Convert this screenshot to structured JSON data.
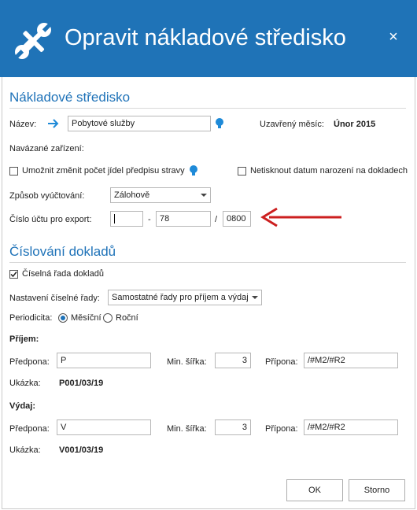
{
  "window": {
    "title": "Opravit nákladové středisko",
    "close_glyph": "×"
  },
  "section1": {
    "title": "Nákladové středisko",
    "name_label": "Název:",
    "name_value": "Pobytové služby",
    "closed_month_label": "Uzavřený měsíc:",
    "closed_month_value": "Únor 2015",
    "linked_devices_label": "Navázané zařízení:",
    "allow_change_label": "Umožnit změnit počet jídel předpisu stravy",
    "allow_change_checked": false,
    "no_birthdate_label": "Netisknout datum narození na dokladech",
    "no_birthdate_checked": false,
    "billing_label": "Způsob vyúčtování:",
    "billing_value": "Zálohově",
    "account_label": "Číslo účtu pro export:",
    "account_prefix": "",
    "account_dash": "-",
    "account_number": "78",
    "account_slash": "/",
    "account_bank": "0800"
  },
  "section2": {
    "title": "Číslování dokladů",
    "series_checkbox_label": "Číselná řada dokladů",
    "series_checked": true,
    "series_setting_label": "Nastavení číselné řady:",
    "series_setting_value": "Samostatné řady pro příjem a výdaj",
    "periodicity_label": "Periodicita:",
    "monthly_label": "Měsíční",
    "yearly_label": "Roční",
    "periodicity_selected": "Měsíční",
    "income": {
      "heading": "Příjem:",
      "prefix_label": "Předpona:",
      "prefix_value": "P",
      "min_width_label": "Min. šířka:",
      "min_width_value": "3",
      "suffix_label": "Přípona:",
      "suffix_value": "/#M2/#R2",
      "example_label": "Ukázka:",
      "example_value": "P001/03/19"
    },
    "expense": {
      "heading": "Výdaj:",
      "prefix_label": "Předpona:",
      "prefix_value": "V",
      "min_width_label": "Min. šířka:",
      "min_width_value": "3",
      "suffix_label": "Přípona:",
      "suffix_value": "/#M2/#R2",
      "example_label": "Ukázka:",
      "example_value": "V001/03/19"
    }
  },
  "buttons": {
    "ok": "OK",
    "cancel": "Storno"
  },
  "colors": {
    "titlebar": "#1f73b7",
    "accent": "#1e72b8",
    "arrow": "#cc1f1f"
  },
  "icons": [
    "wrench-screwdriver-icon",
    "close-icon",
    "arrow-right-icon",
    "lightbulb-icon",
    "chevron-down-icon",
    "red-arrow-annotation"
  ]
}
